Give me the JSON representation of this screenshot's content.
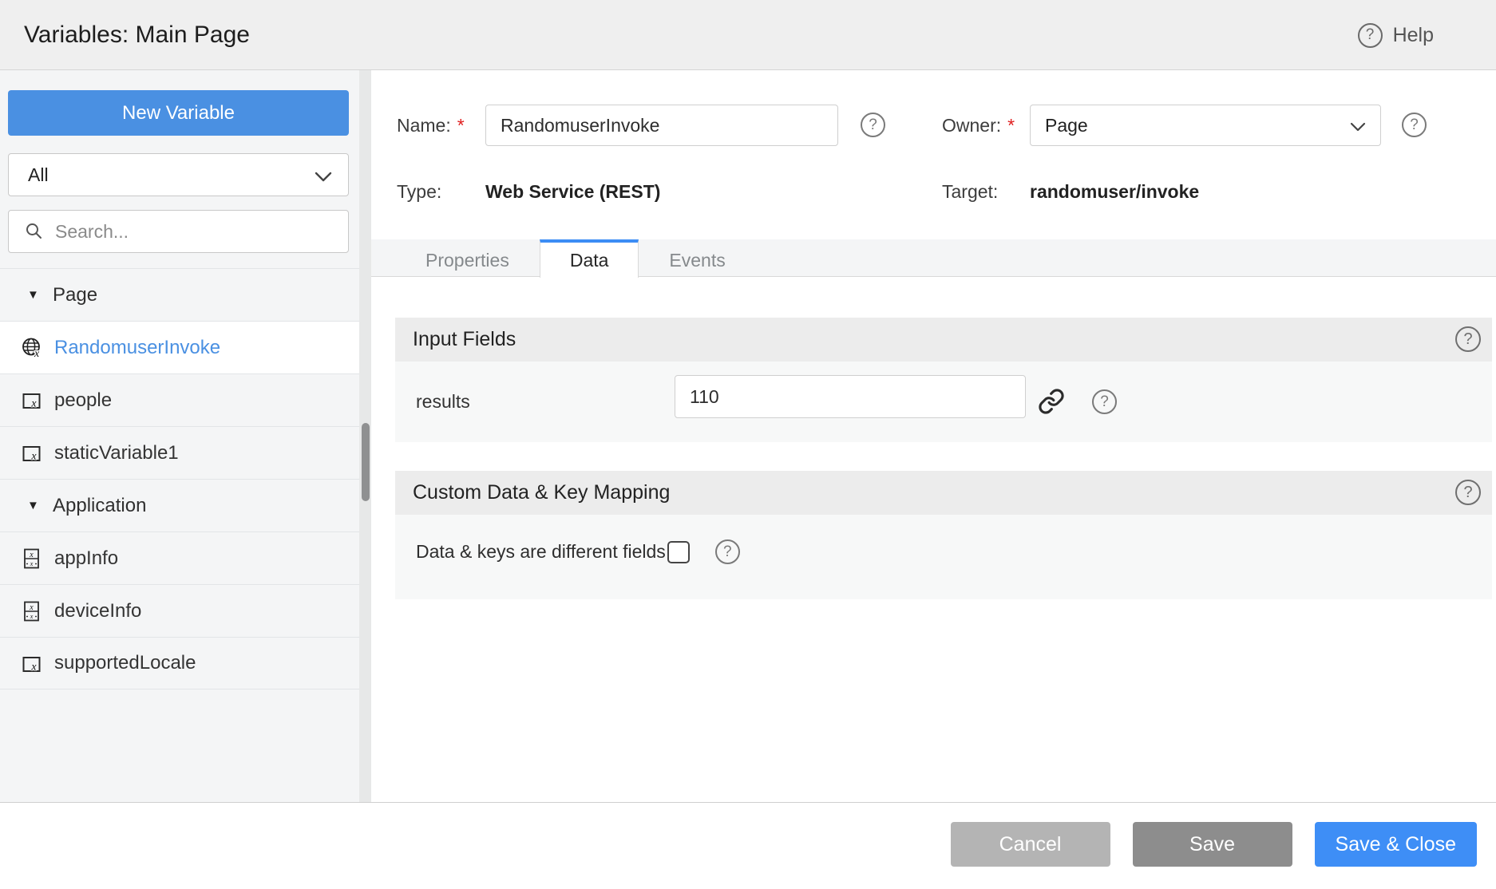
{
  "header": {
    "title": "Variables: Main Page",
    "help_label": "Help"
  },
  "icons": {
    "question_glyph": "?",
    "caret_down_glyph": "▼"
  },
  "sidebar": {
    "new_variable_label": "New Variable",
    "filter_value": "All",
    "search_placeholder": "Search...",
    "items": [
      {
        "label": "Page",
        "type": "group"
      },
      {
        "label": "RandomuserInvoke",
        "type": "webservice",
        "selected": true
      },
      {
        "label": "people",
        "type": "static",
        "selected": false
      },
      {
        "label": "staticVariable1",
        "type": "static",
        "selected": false
      },
      {
        "label": "Application",
        "type": "group"
      },
      {
        "label": "appInfo",
        "type": "model",
        "selected": false
      },
      {
        "label": "deviceInfo",
        "type": "model",
        "selected": false
      },
      {
        "label": "supportedLocale",
        "type": "static",
        "selected": false
      }
    ]
  },
  "form": {
    "name_label": "Name:",
    "name_value": "RandomuserInvoke",
    "owner_label": "Owner:",
    "owner_value": "Page",
    "type_label": "Type:",
    "type_value": "Web Service (REST)",
    "target_label": "Target:",
    "target_value": "randomuser/invoke",
    "required_marker": "*"
  },
  "tabs": [
    {
      "label": "Properties",
      "active": false
    },
    {
      "label": "Data",
      "active": true
    },
    {
      "label": "Events",
      "active": false
    }
  ],
  "sections": {
    "input_fields": {
      "title": "Input Fields",
      "fields": [
        {
          "label": "results",
          "value": "110"
        }
      ]
    },
    "custom_data": {
      "title": "Custom Data & Key Mapping",
      "checkbox_label": "Data & keys are different fields",
      "checked": false
    }
  },
  "footer": {
    "cancel_label": "Cancel",
    "save_label": "Save",
    "save_close_label": "Save & Close"
  },
  "colors": {
    "accent_blue": "#4a90e2",
    "tab_active_border": "#3c8df5",
    "save_close_blue": "#3e8ef6",
    "save_gray": "#8d8d8d",
    "cancel_gray": "#b4b4b4",
    "required_red": "#e02020",
    "selected_item_text": "#4a90e2",
    "section_header_bg": "#ececec",
    "section_body_bg": "#f7f8f8",
    "sidebar_bg": "#f4f5f6"
  }
}
